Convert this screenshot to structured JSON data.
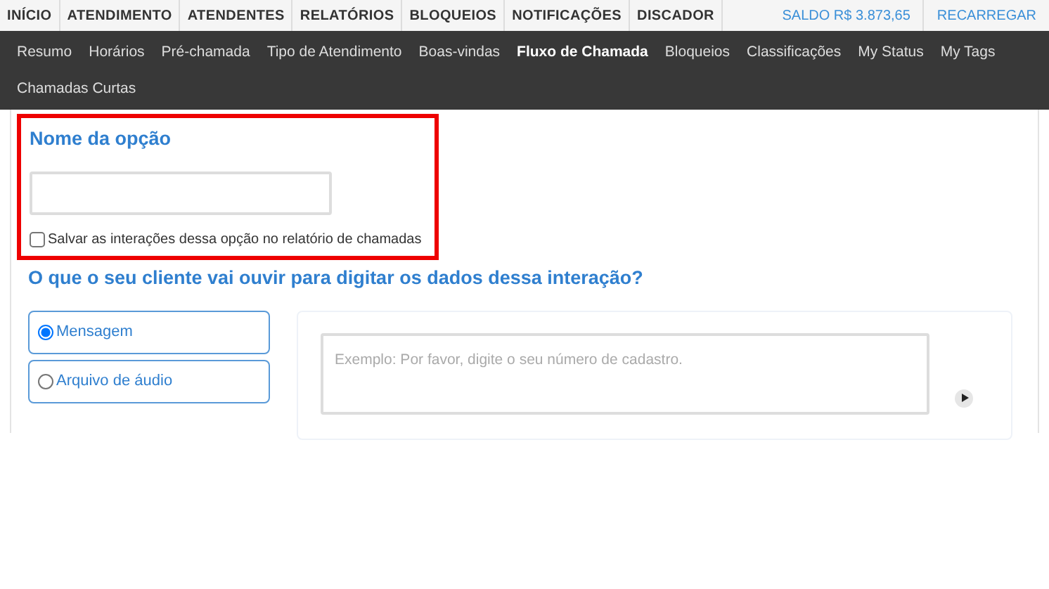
{
  "top_menu": [
    {
      "label": "INÍCIO"
    },
    {
      "label": "ATENDIMENTO"
    },
    {
      "label": "ATENDENTES"
    },
    {
      "label": "RELATÓRIOS"
    },
    {
      "label": "BLOQUEIOS"
    },
    {
      "label": "NOTIFICAÇÕES"
    },
    {
      "label": "DISCADOR"
    }
  ],
  "balance": "SALDO R$ 3.873,65",
  "recharge": "RECARREGAR",
  "sub_menu": [
    {
      "label": "Resumo",
      "selected": false
    },
    {
      "label": "Horários",
      "selected": false
    },
    {
      "label": "Pré-chamada",
      "selected": false
    },
    {
      "label": "Tipo de Atendimento",
      "selected": false
    },
    {
      "label": "Boas-vindas",
      "selected": false
    },
    {
      "label": "Fluxo de Chamada",
      "selected": true
    },
    {
      "label": "Bloqueios",
      "selected": false
    },
    {
      "label": "Classificações",
      "selected": false
    },
    {
      "label": "My Status",
      "selected": false
    },
    {
      "label": "My Tags",
      "selected": false
    },
    {
      "label": "Chamadas Curtas",
      "selected": false
    }
  ],
  "option_name": {
    "title": "Nome da opção",
    "save_checkbox": {
      "label": "Salvar as interações dessa opção no relatório de chamadas",
      "checked": false
    }
  },
  "question": "O que o seu cliente vai ouvir para digitar os dados dessa interação?",
  "audio_types": [
    {
      "label": "Mensagem",
      "selected": true
    },
    {
      "label": "Arquivo de áudio",
      "selected": false
    }
  ],
  "message": {
    "placeholder": "Exemplo: Por favor, digite o seu número de cadastro."
  }
}
